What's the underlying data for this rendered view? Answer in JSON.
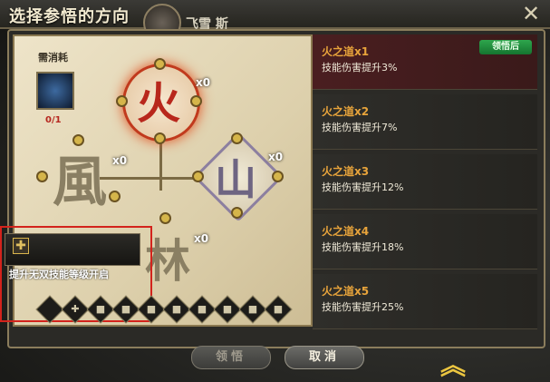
{
  "header": {
    "title": "选择参悟的方向",
    "character_name": "飞雪 斯"
  },
  "cost": {
    "label": "需消耗",
    "count": "0/1"
  },
  "nodes": [
    {
      "glyph": "火",
      "count": "x0",
      "color": "#b8271c"
    },
    {
      "glyph": "風",
      "count": "x0",
      "color": "#8a7f63"
    },
    {
      "glyph": "山",
      "count": "x0",
      "color": "#8f8496"
    },
    {
      "glyph": "林",
      "count": "x0",
      "color": "#8a7f63"
    }
  ],
  "tooltip": {
    "text": "提升无双技能等级开启"
  },
  "skills": [
    {
      "name": "火之道x1",
      "desc": "技能伤害提升3%",
      "badge": "领悟后"
    },
    {
      "name": "火之道x2",
      "desc": "技能伤害提升7%"
    },
    {
      "name": "火之道x3",
      "desc": "技能伤害提升12%"
    },
    {
      "name": "火之道x4",
      "desc": "技能伤害提升18%"
    },
    {
      "name": "火之道x5",
      "desc": "技能伤害提升25%"
    }
  ],
  "buttons": {
    "learn": "领悟",
    "cancel": "取消"
  },
  "colors": {
    "active_item": "#4a1e20",
    "badge": "#2ea64d",
    "warning": "#d3231c"
  }
}
